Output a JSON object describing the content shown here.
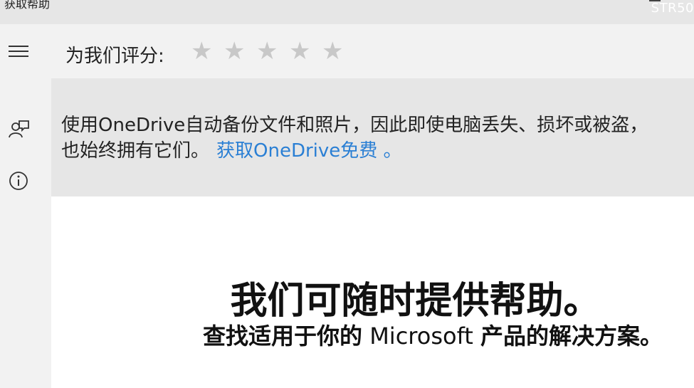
{
  "window": {
    "title": "获取帮助",
    "watermark": "STR50"
  },
  "sidebar": {
    "items": [
      {
        "icon": "hamburger-menu-icon"
      },
      {
        "icon": "feedback-icon"
      },
      {
        "icon": "info-icon"
      }
    ]
  },
  "rating": {
    "label": "为我们评分:",
    "stars": [
      "★",
      "★",
      "★",
      "★",
      "★"
    ],
    "current": 0,
    "max": 5
  },
  "banner": {
    "text_line1": "使用OneDrive自动备份文件和照片，因此即使电脑丢失、损坏或被盗，",
    "text_line2": "也始终拥有它们。",
    "link": "获取OneDrive免费 。"
  },
  "main": {
    "headline": "我们可随时提供帮助。",
    "sub_bold_1": "查找适用于你的",
    "sub_plain": " Microsoft ",
    "sub_bold_2": "产品的解决方案。"
  },
  "colors": {
    "link": "#2a7fd4",
    "star_empty": "#c8c8c8",
    "banner_bg": "#e6e6e6",
    "content_bg": "#ffffff"
  }
}
